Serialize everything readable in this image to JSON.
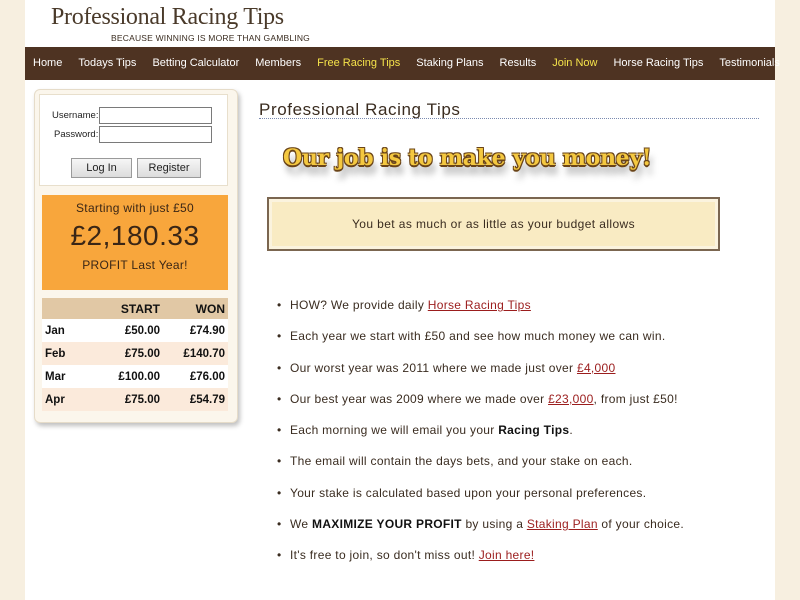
{
  "brand": {
    "title": "Professional Racing Tips",
    "tagline": "BECAUSE WINNING IS MORE THAN GAMBLING"
  },
  "nav": {
    "items": [
      {
        "label": "Home"
      },
      {
        "label": "Todays Tips"
      },
      {
        "label": "Betting Calculator"
      },
      {
        "label": "Members"
      },
      {
        "label": "Free Racing Tips"
      },
      {
        "label": "Staking Plans"
      },
      {
        "label": "Results"
      },
      {
        "label": "Join Now"
      },
      {
        "label": "Horse Racing Tips"
      },
      {
        "label": "Testimonials"
      }
    ]
  },
  "login": {
    "username_label": "Username:",
    "password_label": "Password:",
    "username_value": "",
    "password_value": "",
    "login_button": "Log In",
    "register_button": "Register"
  },
  "profit": {
    "starting": "Starting with just £50",
    "amount": "£2,180.33",
    "caption": "PROFIT Last Year!"
  },
  "results_table": {
    "headers": [
      "",
      "START",
      "WON"
    ],
    "rows": [
      [
        "Jan",
        "£50.00",
        "£74.90"
      ],
      [
        "Feb",
        "£75.00",
        "£140.70"
      ],
      [
        "Mar",
        "£100.00",
        "£76.00"
      ],
      [
        "Apr",
        "£75.00",
        "£54.79"
      ]
    ]
  },
  "content": {
    "title": "Professional Racing Tips",
    "slogan": "Our job is to make you money!",
    "budget_text": "You bet as much or as little as your budget allows",
    "bullet_char": "•",
    "b1": {
      "pre": "HOW? We provide daily ",
      "link": "Horse Racing Tips"
    },
    "b2": {
      "text": "Each year we start with £50 and see how much money we can win."
    },
    "b3": {
      "pre": "Our worst year was 2011 where we made just over ",
      "link": "£4,000"
    },
    "b4": {
      "pre": "Our best year was 2009 where we made over ",
      "link": "£23,000",
      "post": ", from just £50!"
    },
    "b5": {
      "pre": "Each morning we will email you your ",
      "bold": "Racing Tips",
      "post": "."
    },
    "b6": {
      "text": "The email will contain the days bets, and your stake on each."
    },
    "b7": {
      "text": "Your stake is calculated based upon your personal preferences."
    },
    "b8": {
      "pre": "We ",
      "bold": "MAXIMIZE YOUR PROFIT",
      "mid": " by using a ",
      "link": "Staking Plan",
      "post": " of your choice."
    },
    "b9": {
      "pre": "It's free to join, so don't miss out! ",
      "link": "Join here!"
    }
  }
}
